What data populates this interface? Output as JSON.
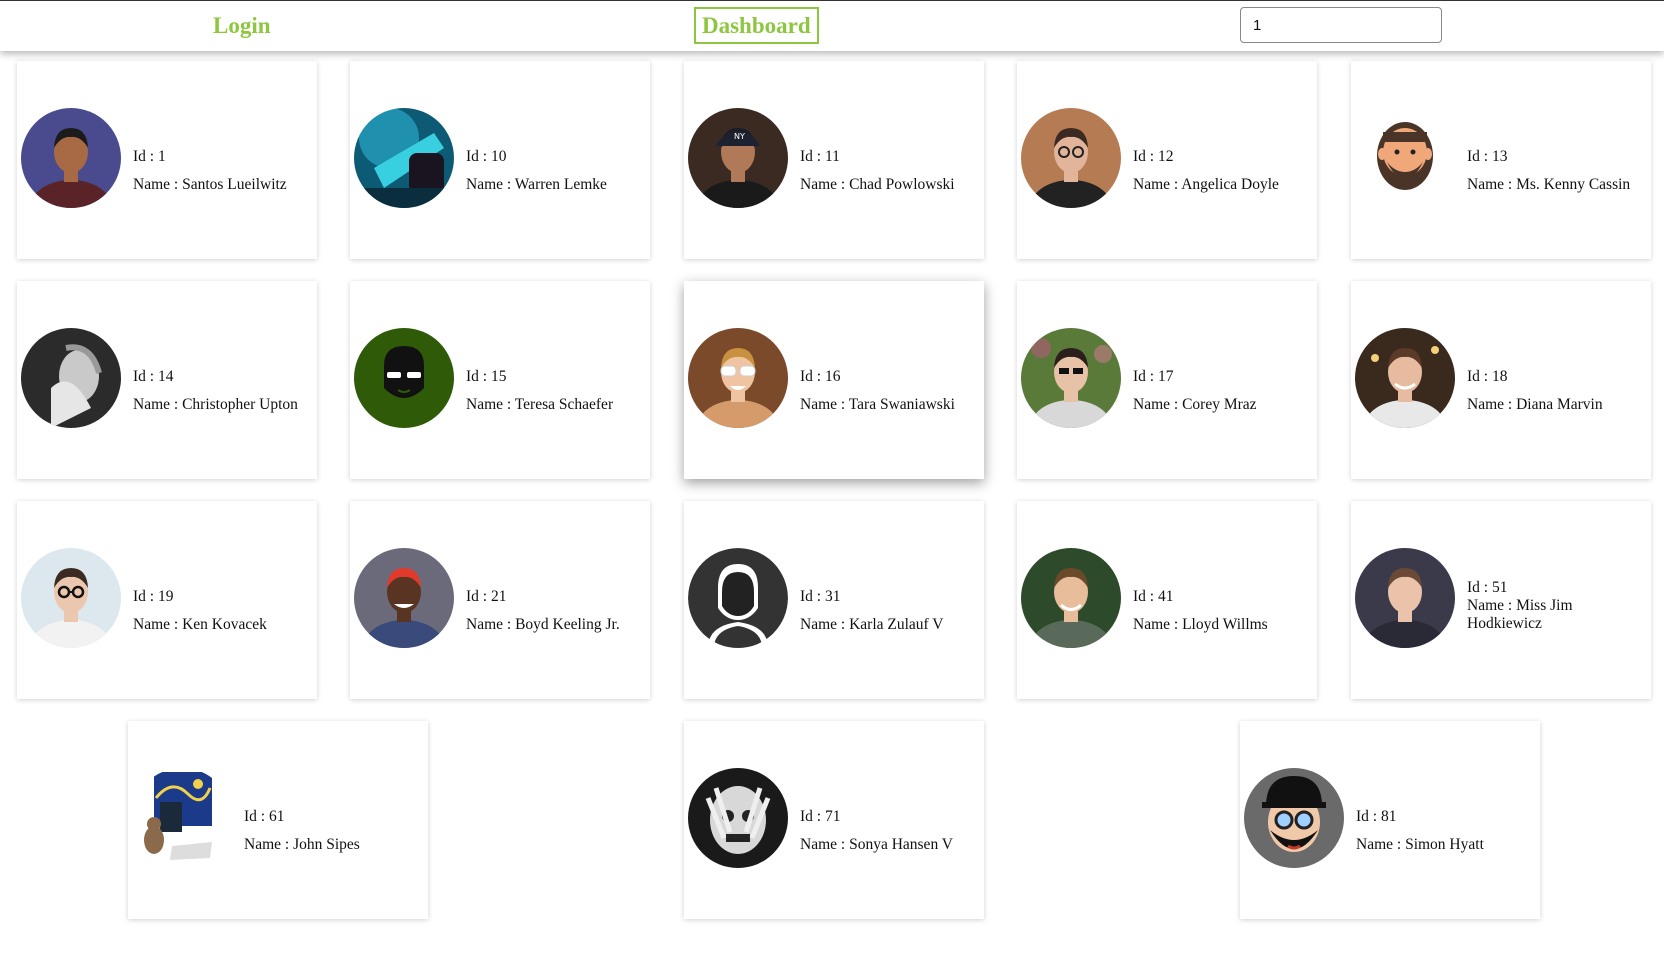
{
  "nav": {
    "login_label": "Login",
    "dashboard_label": "Dashboard",
    "search_value": "1",
    "accent_color": "#8dc63f"
  },
  "id_prefix": "Id : ",
  "name_prefix": "Name : ",
  "users": [
    {
      "id": "1",
      "name": "Santos Lueilwitz"
    },
    {
      "id": "10",
      "name": "Warren Lemke"
    },
    {
      "id": "11",
      "name": "Chad Powlowski"
    },
    {
      "id": "12",
      "name": "Angelica Doyle"
    },
    {
      "id": "13",
      "name": "Ms. Kenny Cassin"
    },
    {
      "id": "14",
      "name": "Christopher Upton"
    },
    {
      "id": "15",
      "name": "Teresa Schaefer"
    },
    {
      "id": "16",
      "name": "Tara Swaniawski"
    },
    {
      "id": "17",
      "name": "Corey Mraz"
    },
    {
      "id": "18",
      "name": "Diana Marvin"
    },
    {
      "id": "19",
      "name": "Ken Kovacek"
    },
    {
      "id": "21",
      "name": "Boyd Keeling Jr."
    },
    {
      "id": "31",
      "name": "Karla Zulauf V"
    },
    {
      "id": "41",
      "name": "Lloyd Willms"
    },
    {
      "id": "51",
      "name": "Miss Jim Hodkiewicz"
    },
    {
      "id": "61",
      "name": "John Sipes"
    },
    {
      "id": "71",
      "name": "Sonya Hansen V"
    },
    {
      "id": "81",
      "name": "Simon Hyatt"
    }
  ]
}
